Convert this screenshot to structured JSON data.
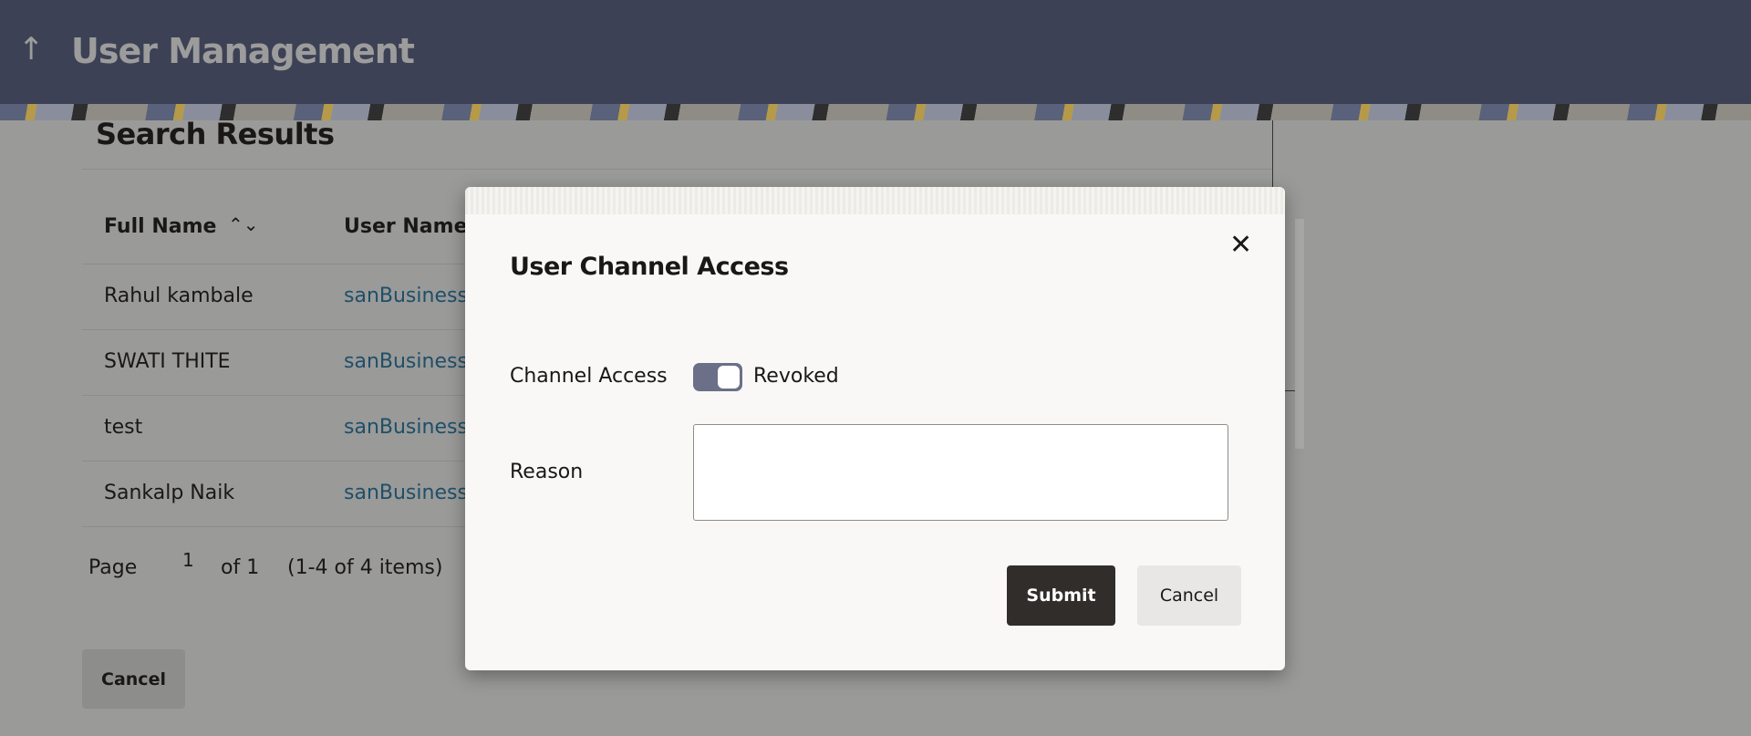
{
  "header": {
    "title": "User Management",
    "back_icon": "arrow-up-icon"
  },
  "results": {
    "title": "Search Results",
    "columns": [
      "Full Name",
      "User Name"
    ],
    "rows": [
      {
        "full_name": "Rahul kambale",
        "user_name": "sanBusiness"
      },
      {
        "full_name": "SWATI THITE",
        "user_name": "sanBusiness"
      },
      {
        "full_name": "test",
        "user_name": "sanBusiness"
      },
      {
        "full_name": "Sankalp Naik",
        "user_name": "sanBusiness"
      }
    ],
    "pager": {
      "page_label": "Page",
      "page": "1",
      "of": "of 1",
      "items": "(1-4 of 4 items)"
    },
    "cancel_label": "Cancel"
  },
  "modal": {
    "title": "User Channel Access",
    "channel_access_label": "Channel Access",
    "toggle_state": "Revoked",
    "reason_label": "Reason",
    "reason_value": "",
    "submit_label": "Submit",
    "cancel_label": "Cancel"
  }
}
